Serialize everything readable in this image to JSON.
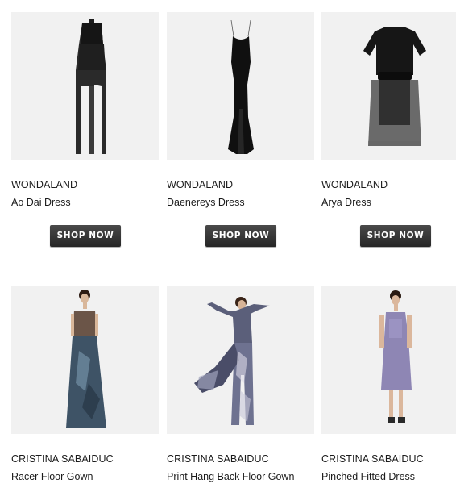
{
  "products": [
    {
      "brand": "WONDALAND",
      "name": "Ao Dai Dress",
      "button": "SHOP NOW",
      "image": "black-ao-dai-dress"
    },
    {
      "brand": "WONDALAND",
      "name": "Daenereys Dress",
      "button": "SHOP NOW",
      "image": "black-slip-gown"
    },
    {
      "brand": "WONDALAND",
      "name": "Arya Dress",
      "button": "SHOP NOW",
      "image": "black-sheer-overlay-dress"
    },
    {
      "brand": "CRISTINA SABAIDUC",
      "name": "Racer Floor Gown",
      "image": "model-racer-floor-gown"
    },
    {
      "brand": "CRISTINA SABAIDUC",
      "name": "Print Hang Back Floor Gown",
      "image": "model-printed-floor-gown"
    },
    {
      "brand": "CRISTINA SABAIDUC",
      "name": "Pinched Fitted Dress",
      "image": "model-lavender-fitted-dress"
    }
  ],
  "colors": {
    "button_bg": "#333333",
    "image_bg": "#f1f1f1",
    "text": "#1b1b1b"
  }
}
